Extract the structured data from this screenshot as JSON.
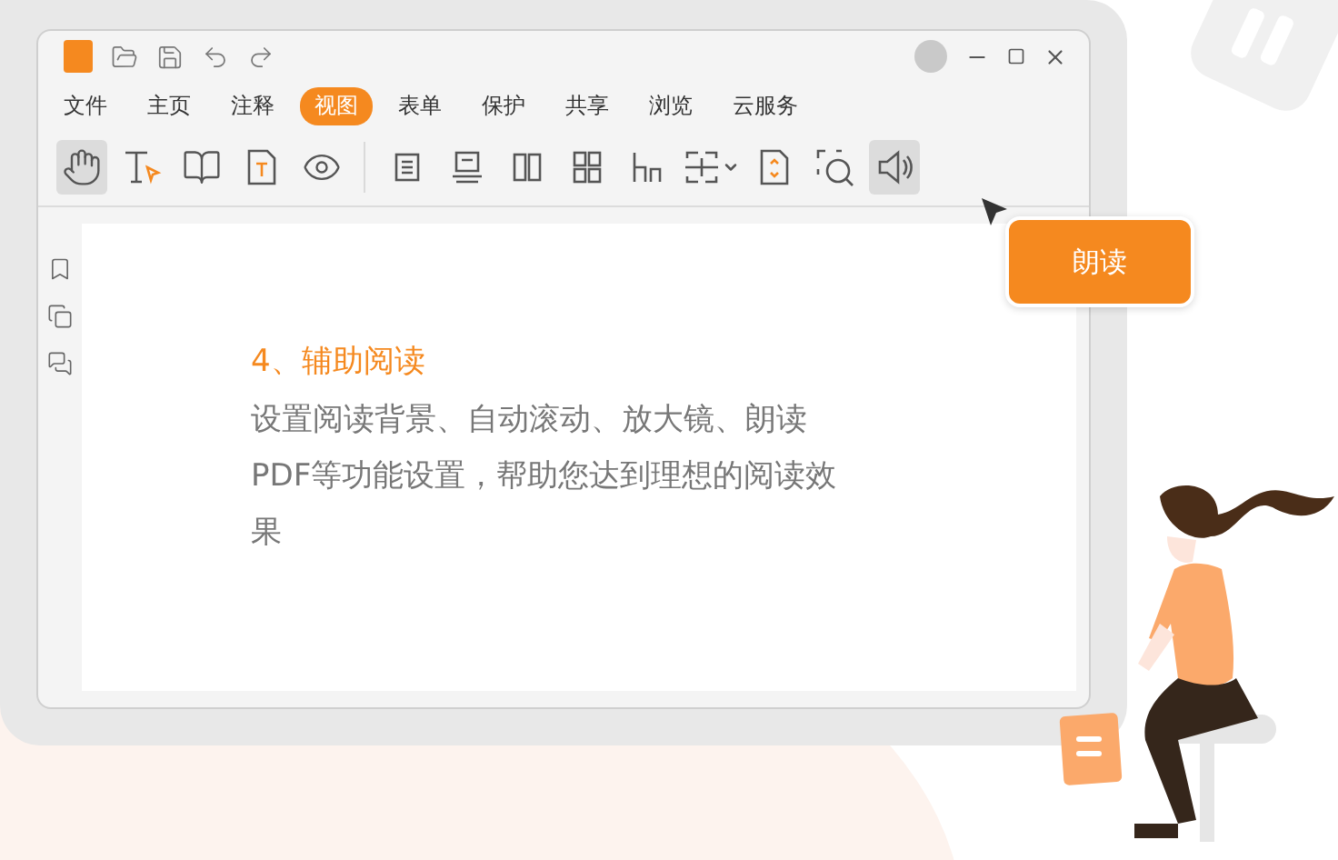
{
  "menu": [
    {
      "label": "文件",
      "selected": false
    },
    {
      "label": "主页",
      "selected": false
    },
    {
      "label": "注释",
      "selected": false
    },
    {
      "label": "视图",
      "selected": true
    },
    {
      "label": "表单",
      "selected": false
    },
    {
      "label": "保护",
      "selected": false
    },
    {
      "label": "共享",
      "selected": false
    },
    {
      "label": "浏览",
      "selected": false
    },
    {
      "label": "云服务",
      "selected": false
    }
  ],
  "toolbar": [
    {
      "kind": "hand",
      "selected": true
    },
    {
      "kind": "select-text",
      "selected": false
    },
    {
      "kind": "book",
      "selected": false
    },
    {
      "kind": "text-page",
      "selected": false
    },
    {
      "kind": "eye",
      "selected": false
    },
    {
      "kind": "divider"
    },
    {
      "kind": "single-page",
      "selected": false
    },
    {
      "kind": "continuous",
      "selected": false
    },
    {
      "kind": "two-column",
      "selected": false
    },
    {
      "kind": "grid",
      "selected": false
    },
    {
      "kind": "reflow",
      "selected": false
    },
    {
      "kind": "split",
      "selected": false
    },
    {
      "kind": "fit-page",
      "selected": false
    },
    {
      "kind": "zoom-area",
      "selected": false
    },
    {
      "kind": "speaker",
      "selected": true
    }
  ],
  "tooltip": {
    "label": "朗读"
  },
  "content": {
    "heading": "4、辅助阅读",
    "body_lines": [
      "设置阅读背景、自动滚动、放大镜、朗读",
      "PDF等功能设置，帮助您达到理想的阅读效",
      "果"
    ]
  }
}
